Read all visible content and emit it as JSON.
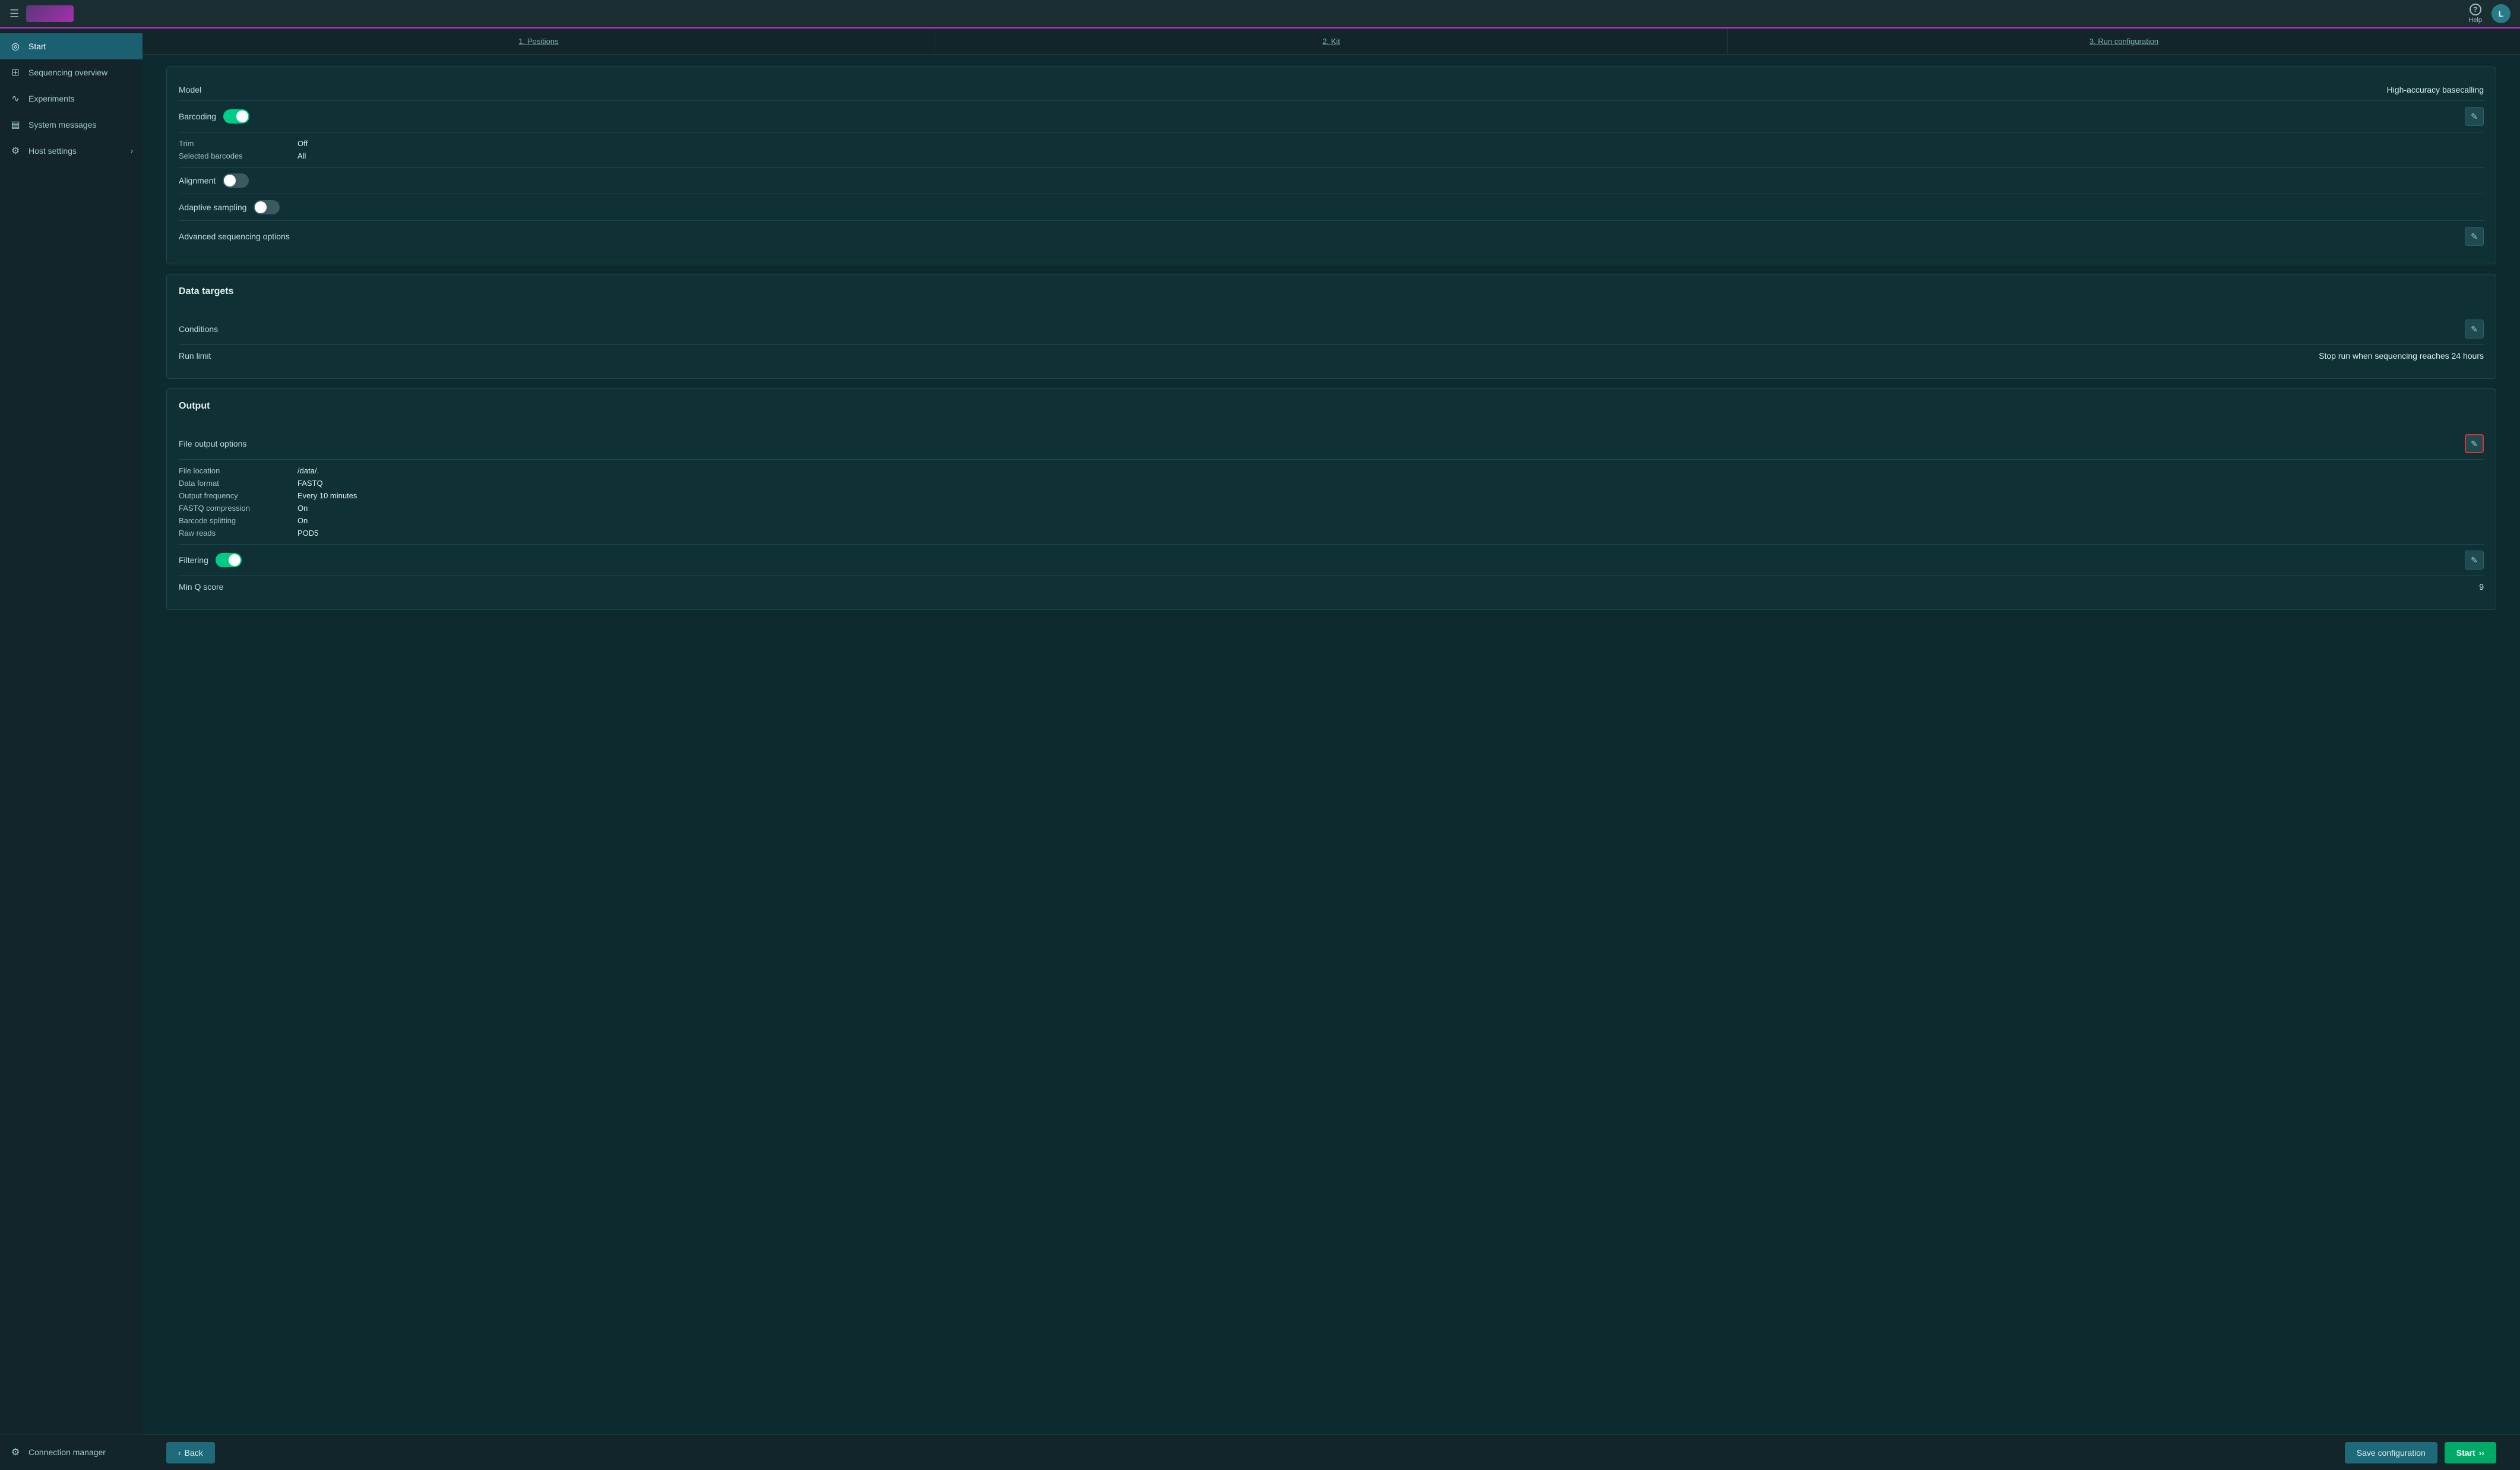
{
  "topbar": {
    "help_label": "Help",
    "user_initial": "L"
  },
  "sidebar": {
    "items": [
      {
        "id": "start",
        "label": "Start",
        "icon": "●",
        "active": true
      },
      {
        "id": "sequencing-overview",
        "label": "Sequencing overview",
        "icon": "⊞",
        "active": false
      },
      {
        "id": "experiments",
        "label": "Experiments",
        "icon": "∿",
        "active": false
      },
      {
        "id": "system-messages",
        "label": "System messages",
        "icon": "💬",
        "active": false
      },
      {
        "id": "host-settings",
        "label": "Host settings",
        "icon": "⚙",
        "active": false,
        "has_chevron": true
      }
    ],
    "footer": {
      "connection_manager_label": "Connection manager",
      "icon": "⚙"
    }
  },
  "steps": [
    {
      "id": "positions",
      "label": "1. Positions"
    },
    {
      "id": "kit",
      "label": "2. Kit"
    },
    {
      "id": "run-configuration",
      "label": "3. Run configuration"
    }
  ],
  "cards": {
    "basecalling": {
      "model_label": "Model",
      "model_value": "High-accuracy basecalling",
      "barcoding_label": "Barcoding",
      "barcoding_toggle": "on",
      "trim_label": "Trim",
      "trim_value": "Off",
      "selected_barcodes_label": "Selected barcodes",
      "selected_barcodes_value": "All",
      "alignment_label": "Alignment",
      "alignment_toggle": "off",
      "adaptive_sampling_label": "Adaptive sampling",
      "adaptive_sampling_toggle": "off",
      "advanced_label": "Advanced sequencing options"
    },
    "data_targets": {
      "title": "Data targets",
      "conditions_label": "Conditions",
      "run_limit_label": "Run limit",
      "run_limit_value": "Stop run when sequencing reaches 24 hours"
    },
    "output": {
      "title": "Output",
      "file_output_options_label": "File output options",
      "file_location_label": "File location",
      "file_location_value": "/data/.",
      "data_format_label": "Data format",
      "data_format_value": "FASTQ",
      "output_frequency_label": "Output frequency",
      "output_frequency_value": "Every 10 minutes",
      "fastq_compression_label": "FASTQ compression",
      "fastq_compression_value": "On",
      "barcode_splitting_label": "Barcode splitting",
      "barcode_splitting_value": "On",
      "raw_reads_label": "Raw reads",
      "raw_reads_value": "POD5",
      "filtering_label": "Filtering",
      "filtering_toggle": "on",
      "min_q_score_label": "Min Q score",
      "min_q_score_value": "9"
    }
  },
  "footer": {
    "back_label": "Back",
    "save_configuration_label": "Save configuration",
    "start_label": "Start"
  }
}
